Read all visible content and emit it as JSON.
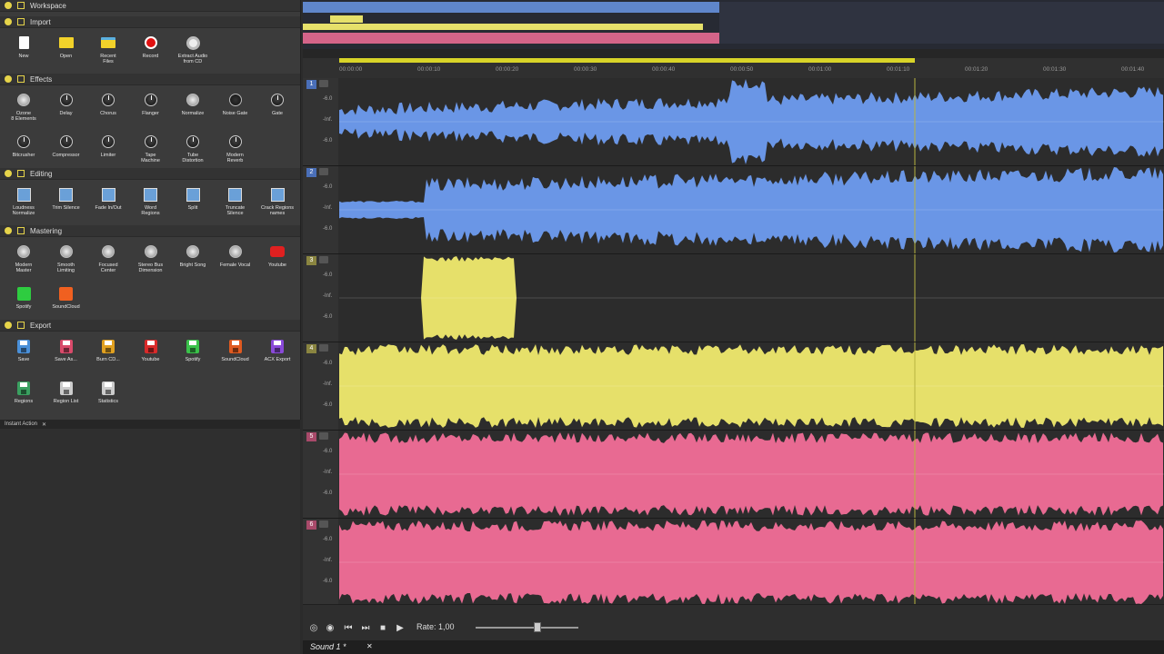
{
  "sections": {
    "workspace": "Workspace",
    "import": "Import",
    "effects": "Effects",
    "editing": "Editing",
    "mastering": "Mastering",
    "export": "Export"
  },
  "import_tools": [
    {
      "label": "New",
      "icon": "new-file-icon"
    },
    {
      "label": "Open",
      "icon": "folder-icon"
    },
    {
      "label": "Recent\nFiles",
      "icon": "recent-folder-icon"
    },
    {
      "label": "Record",
      "icon": "record-icon"
    },
    {
      "label": "Extract Audio\nfrom CD",
      "icon": "cd-icon"
    }
  ],
  "effect_tools": [
    {
      "label": "Ozone\n8 Elements",
      "icon": "ozone-dial-icon"
    },
    {
      "label": "Delay",
      "icon": "knob-icon"
    },
    {
      "label": "Chorus",
      "icon": "knob-icon"
    },
    {
      "label": "Flanger",
      "icon": "knob-icon"
    },
    {
      "label": "Normalize",
      "icon": "normalize-icon"
    },
    {
      "label": "Noise Gate",
      "icon": "noise-gate-icon"
    },
    {
      "label": "Gate",
      "icon": "knob-icon"
    },
    {
      "label": "Bitcrusher",
      "icon": "knob-icon"
    },
    {
      "label": "Compressor",
      "icon": "knob-icon"
    },
    {
      "label": "Limiter",
      "icon": "knob-icon"
    },
    {
      "label": "Tape\nMachine",
      "icon": "knob-icon"
    },
    {
      "label": "Tube\nDistortion",
      "icon": "knob-icon"
    },
    {
      "label": "Modern\nReverb",
      "icon": "knob-icon"
    }
  ],
  "editing_tools": [
    {
      "label": "Loudness\nNormalize",
      "icon": "loudness-icon"
    },
    {
      "label": "Trim Silence",
      "icon": "trim-icon"
    },
    {
      "label": "Fade In/Out",
      "icon": "fade-icon"
    },
    {
      "label": "Word\nRegions",
      "icon": "word-regions-icon"
    },
    {
      "label": "Split",
      "icon": "split-icon"
    },
    {
      "label": "Truncate\nSilence",
      "icon": "truncate-icon"
    },
    {
      "label": "Crack Regions\nnames",
      "icon": "regions-names-icon"
    }
  ],
  "mastering_tools": [
    {
      "label": "Modern\nMaster",
      "icon": "dial-icon"
    },
    {
      "label": "Smooth\nLimiting",
      "icon": "dial-icon"
    },
    {
      "label": "Focused\nCenter",
      "icon": "dial-icon"
    },
    {
      "label": "Stereo Bus\nDimension",
      "icon": "dial-icon"
    },
    {
      "label": "Bright Song",
      "icon": "dial-icon"
    },
    {
      "label": "Female Vocal",
      "icon": "dial-icon"
    },
    {
      "label": "Youtube",
      "icon": "youtube-icon"
    },
    {
      "label": "Spotify",
      "icon": "spotify-icon"
    },
    {
      "label": "SoundCloud",
      "icon": "soundcloud-icon"
    }
  ],
  "export_tools": [
    {
      "label": "Save",
      "icon": "save-icon",
      "color": "#4a90d9"
    },
    {
      "label": "Save As...",
      "icon": "save-as-icon",
      "color": "#d94a6a"
    },
    {
      "label": "Burn CD...",
      "icon": "burn-cd-icon",
      "color": "#e0a020"
    },
    {
      "label": "Youtube",
      "icon": "youtube-save-icon",
      "color": "#d92a2a"
    },
    {
      "label": "Spotify",
      "icon": "spotify-save-icon",
      "color": "#3ac24a"
    },
    {
      "label": "SoundCloud",
      "icon": "soundcloud-save-icon",
      "color": "#e05a20"
    },
    {
      "label": "ACX Export",
      "icon": "acx-export-icon",
      "color": "#8a4ad9"
    },
    {
      "label": "Regions",
      "icon": "regions-icon",
      "color": "#3aa060"
    },
    {
      "label": "Region List",
      "icon": "region-list-icon",
      "color": "#cccccc"
    },
    {
      "label": "Statistics",
      "icon": "statistics-icon",
      "color": "#cccccc"
    }
  ],
  "instant_action": "Instant Action",
  "ruler_ticks": [
    "00:00:00",
    "00:00:10",
    "00:00:20",
    "00:00:30",
    "00:00:40",
    "00:00:50",
    "00:01:00",
    "00:01:10",
    "00:01:20",
    "00:01:30",
    "00:01:40"
  ],
  "tracks": [
    {
      "num": "1",
      "color": "#6a96e6",
      "db": [
        "-6.0",
        "-Inf.",
        "-6.0"
      ],
      "num_bg": "#4a6fb8"
    },
    {
      "num": "2",
      "color": "#6a96e6",
      "db": [
        "-6.0",
        "-Inf.",
        "-6.0"
      ],
      "num_bg": "#4a6fb8"
    },
    {
      "num": "3",
      "color": "#e6e06a",
      "db": [
        "-6.0",
        "-Inf.",
        "-6.0"
      ],
      "num_bg": "#8a8540"
    },
    {
      "num": "4",
      "color": "#e6e06a",
      "db": [
        "-6.0",
        "-Inf.",
        "-6.0"
      ],
      "num_bg": "#8a8540"
    },
    {
      "num": "5",
      "color": "#e86a92",
      "db": [
        "-6.0",
        "-Inf.",
        "-6.0"
      ],
      "num_bg": "#a84a6a"
    },
    {
      "num": "6",
      "color": "#e86a92",
      "db": [
        "-6.0",
        "-Inf.",
        "-6.0"
      ],
      "num_bg": "#a84a6a"
    }
  ],
  "transport": {
    "rate_label": "Rate: 1,00",
    "rate_value": 1.0
  },
  "doc_tab": "Sound 1 *"
}
